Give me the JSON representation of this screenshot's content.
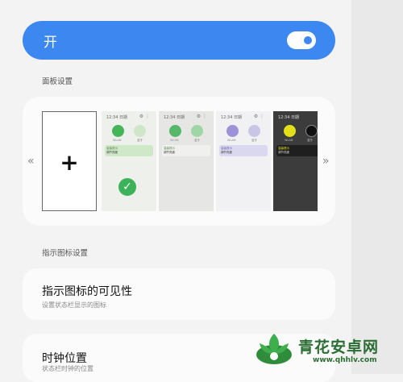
{
  "master": {
    "label": "开",
    "on": true,
    "accent": "#3c87f0"
  },
  "panel_section": {
    "title": "面板设置",
    "nav_prev": "«",
    "nav_next": "»",
    "add_label": "+",
    "themes": [
      {
        "time": "12:34 日期",
        "gear": "⚙ ⋮",
        "label1": "WLAN",
        "label2": "蓝牙",
        "bar_text1": "温馨提示",
        "bar_text2": "调节亮度",
        "selected": true
      },
      {
        "time": "12:34 日期",
        "gear": "⚙ ⋮",
        "label1": "WLAN",
        "label2": "蓝牙",
        "bar_text1": "温馨提示",
        "bar_text2": "调节亮度",
        "selected": false
      },
      {
        "time": "12:34 日期",
        "gear": "⚙ ⋮",
        "label1": "WLAN",
        "label2": "蓝牙",
        "bar_text1": "温馨提示",
        "bar_text2": "调节亮度",
        "selected": false
      },
      {
        "time": "12:34 日期",
        "gear": "⚙ ⋮",
        "label1": "WLAN",
        "label2": "蓝牙",
        "bar_text1": "温馨提示",
        "bar_text2": "调节亮度",
        "selected": false
      }
    ],
    "check_mark": "✓"
  },
  "indicator_section": {
    "title": "指示图标设置",
    "items": [
      {
        "title": "指示图标的可见性",
        "subtitle": "设置状态栏显示的图标"
      },
      {
        "title": "时钟位置",
        "subtitle": "状态栏时钟的位置"
      }
    ]
  },
  "watermark": {
    "name": "青花安卓网",
    "url": "www.qhhlv.com"
  }
}
